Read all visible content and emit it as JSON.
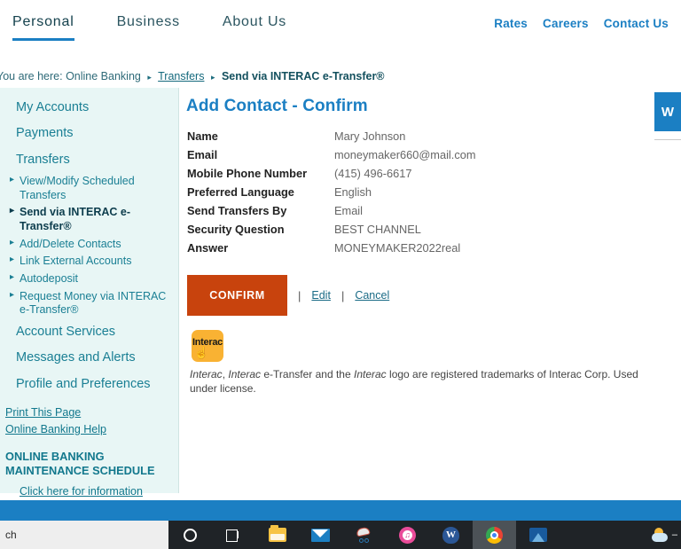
{
  "topnav": {
    "main_items": [
      {
        "label": "Personal",
        "active": true
      },
      {
        "label": "Business",
        "active": false
      },
      {
        "label": "About Us",
        "active": false
      }
    ],
    "util_items": [
      {
        "label": "Rates"
      },
      {
        "label": "Careers"
      },
      {
        "label": "Contact Us"
      }
    ]
  },
  "breadcrumb": {
    "lead": "You are here: Online Banking",
    "sep": "▸",
    "link": "Transfers",
    "current": "Send via INTERAC e-Transfer®"
  },
  "sidebar": {
    "main_items": [
      {
        "label": "My Accounts"
      },
      {
        "label": "Payments"
      },
      {
        "label": "Transfers"
      }
    ],
    "sub_items": [
      {
        "label": "View/Modify Scheduled Transfers",
        "active": false
      },
      {
        "label": "Send via INTERAC e-Transfer®",
        "active": true
      },
      {
        "label": "Add/Delete Contacts",
        "active": false
      },
      {
        "label": "Link External Accounts",
        "active": false
      },
      {
        "label": "Autodeposit",
        "active": false
      },
      {
        "label": "Request Money via INTERAC e-Transfer®",
        "active": false
      }
    ],
    "main_items_after": [
      {
        "label": "Account Services"
      },
      {
        "label": "Messages and Alerts"
      },
      {
        "label": "Profile and Preferences"
      }
    ],
    "utility_links": [
      {
        "label": "Print This Page"
      },
      {
        "label": "Online Banking Help"
      }
    ],
    "maintenance_heading": "ONLINE BANKING MAINTENANCE SCHEDULE",
    "maintenance_link": "Click here for information"
  },
  "main": {
    "page_title": "Add Contact - Confirm",
    "fields": [
      {
        "label": "Name",
        "value": "Mary Johnson"
      },
      {
        "label": "Email",
        "value": "moneymaker660@mail.com"
      },
      {
        "label": "Mobile Phone Number",
        "value": "(415) 496-6617"
      },
      {
        "label": "Preferred Language",
        "value": "English"
      },
      {
        "label": "Send Transfers By",
        "value": "Email"
      },
      {
        "label": "Security Question",
        "value": "BEST CHANNEL"
      },
      {
        "label": "Answer",
        "value": "MONEYMAKER2022real"
      }
    ],
    "confirm_label": "CONFIRM",
    "edit_label": "Edit",
    "cancel_label": "Cancel",
    "separator": "|",
    "interac_logo_text": "Interac",
    "trademark_parts": {
      "p1": "Interac",
      "p2": ", ",
      "p3": "Interac",
      "p4": " e-Transfer and the ",
      "p5": "Interac",
      "p6": " logo are registered trademarks of Interac Corp. Used under license."
    }
  },
  "side_tab": {
    "label": "W"
  },
  "taskbar": {
    "search_text": "ch",
    "items": [
      {
        "name": "cortana-icon"
      },
      {
        "name": "task-view-icon"
      },
      {
        "name": "file-explorer-icon"
      },
      {
        "name": "mail-icon"
      },
      {
        "name": "snip-sketch-icon"
      },
      {
        "name": "itunes-icon"
      },
      {
        "name": "word-icon"
      },
      {
        "name": "chrome-icon"
      },
      {
        "name": "photos-icon"
      }
    ],
    "weather_temp": "–"
  },
  "colors": {
    "accent_blue": "#1b7fc3",
    "teal": "#1a7f94",
    "confirm_orange": "#c8430d",
    "interac_yellow": "#f9b233",
    "sidebar_bg": "#e8f6f5"
  }
}
